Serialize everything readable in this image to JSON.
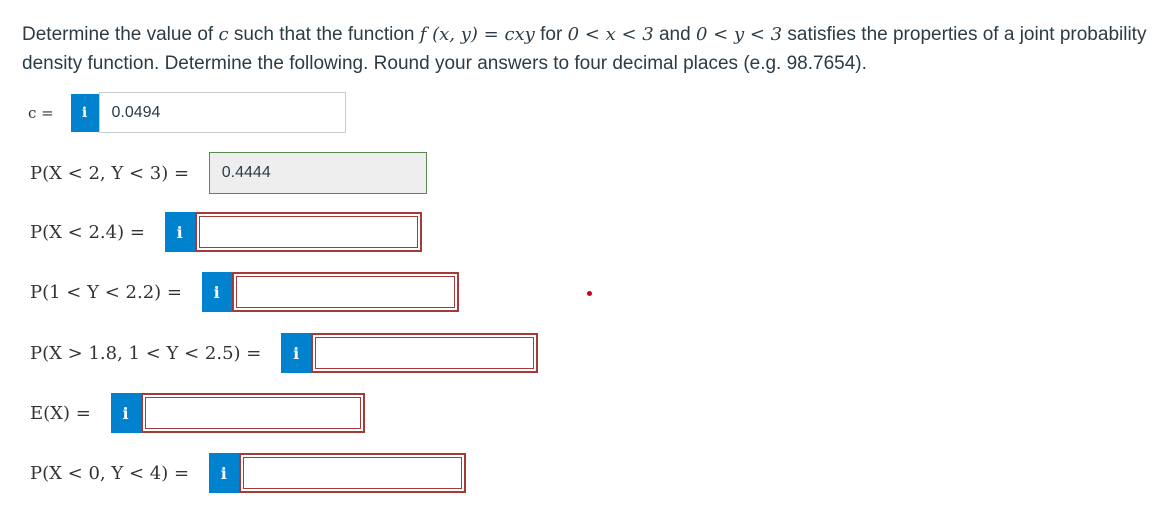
{
  "problem": {
    "t1": "Determine the value of ",
    "c_var": "c",
    "t2": " such that the function ",
    "f_expr": "f (x, y) = cxy",
    "t3": " for ",
    "range_x": "0 < x < 3",
    "t4": " and ",
    "range_y": "0 < y < 3",
    "t5": " satisfies the properties of a joint probability density function. Determine the following. Round your answers to four decimal places (e.g. 98.7654)."
  },
  "info_glyph": "i",
  "answers": [
    {
      "label": "c = ",
      "value": "0.0494",
      "status": "entered"
    },
    {
      "label": "P(X < 2, Y < 3) = ",
      "value": "0.4444",
      "status": "correct"
    },
    {
      "label": "P(X < 2.4) = ",
      "value": "",
      "status": "empty"
    },
    {
      "label": "P(1 < Y < 2.2) = ",
      "value": "",
      "status": "empty"
    },
    {
      "label": "P(X > 1.8, 1 < Y < 2.5) = ",
      "value": "",
      "status": "empty"
    },
    {
      "label": "E(X) = ",
      "value": "",
      "status": "empty"
    },
    {
      "label": "P(X < 0, Y < 4) = ",
      "value": "",
      "status": "empty"
    }
  ],
  "colors": {
    "info_button": "#0082ce",
    "error_border": "#a53a3a",
    "correct_border": "#5a8a52",
    "correct_fill": "#eeeeee"
  }
}
